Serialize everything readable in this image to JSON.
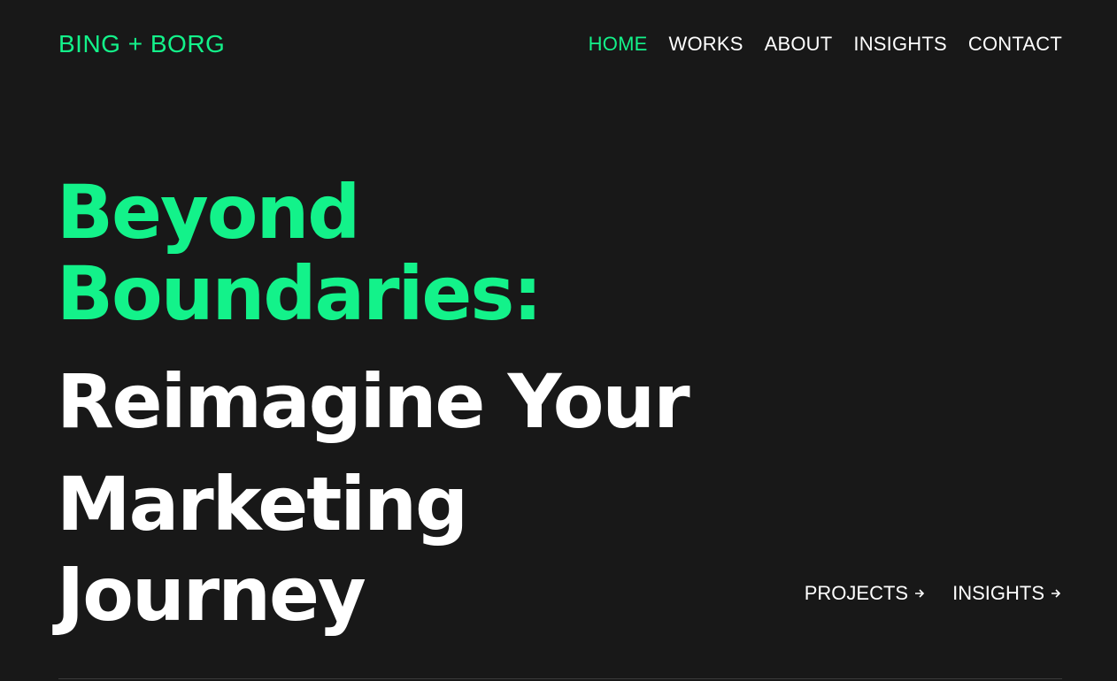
{
  "brand": {
    "logo_text": "BING + BORG"
  },
  "nav": {
    "items": [
      {
        "label": "HOME",
        "active": true
      },
      {
        "label": "WORKS",
        "active": false
      },
      {
        "label": "ABOUT",
        "active": false
      },
      {
        "label": "INSIGHTS",
        "active": false
      },
      {
        "label": "CONTACT",
        "active": false
      }
    ]
  },
  "hero": {
    "headline_accent_line1": "Beyond",
    "headline_accent_line2": "Boundaries:",
    "headline_line3": "Reimagine Your",
    "headline_line4": "Marketing",
    "headline_line5": "Journey"
  },
  "quick_links": {
    "items": [
      {
        "label": "PROJECTS",
        "icon": "arrow-right-icon"
      },
      {
        "label": "INSIGHTS",
        "icon": "arrow-right-icon"
      }
    ]
  },
  "colors": {
    "background": "#181818",
    "accent": "#13f28a",
    "text": "#ffffff"
  }
}
